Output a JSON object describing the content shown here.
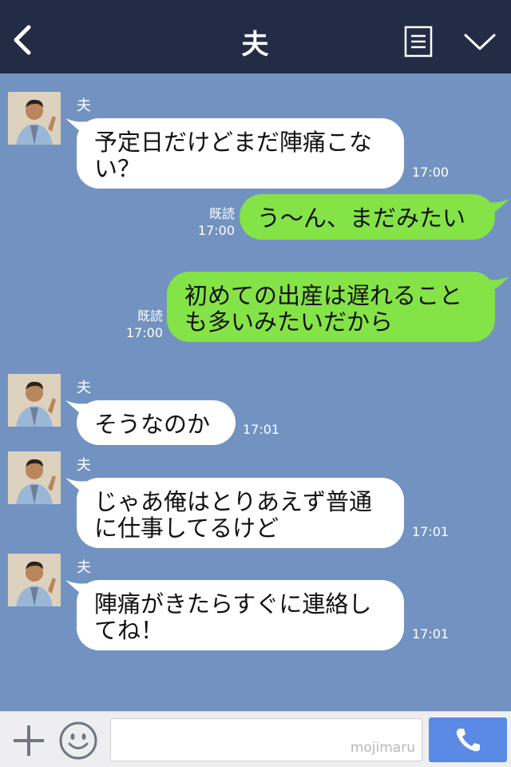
{
  "header": {
    "title": "夫",
    "back_icon": "chevron-left-icon",
    "menu_icon": "menu-list-icon",
    "collapse_icon": "chevron-down-icon"
  },
  "messages": [
    {
      "side": "in",
      "sender": "夫",
      "lines": [
        "予定日だけどまだ陣痛こな",
        "い？"
      ],
      "time": "17:00"
    },
    {
      "side": "out",
      "read": "既読",
      "lines": [
        "う〜ん、まだみたい"
      ],
      "time": "17:00"
    },
    {
      "side": "out",
      "read": "既読",
      "lines": [
        "初めての出産は遅れること",
        "も多いみたいだから"
      ],
      "time": "17:00"
    },
    {
      "side": "in",
      "sender": "夫",
      "lines": [
        "そうなのか"
      ],
      "time": "17:01"
    },
    {
      "side": "in",
      "sender": "夫",
      "lines": [
        "じゃあ俺はとりあえず普通",
        "に仕事してるけど"
      ],
      "time": "17:01"
    },
    {
      "side": "in",
      "sender": "夫",
      "lines": [
        "陣痛がきたらすぐに連絡し",
        "てね！"
      ],
      "time": "17:01"
    }
  ],
  "footer": {
    "input_placeholder": "",
    "watermark": "mojimaru",
    "plus_icon": "plus-icon",
    "sticker_icon": "smiley-icon",
    "call_icon": "phone-icon"
  },
  "colors": {
    "header_bg": "#232c45",
    "chat_bg": "#7293c1",
    "incoming_bubble": "#ffffff",
    "outgoing_bubble": "#84e346",
    "call_button": "#5a8ae6"
  }
}
